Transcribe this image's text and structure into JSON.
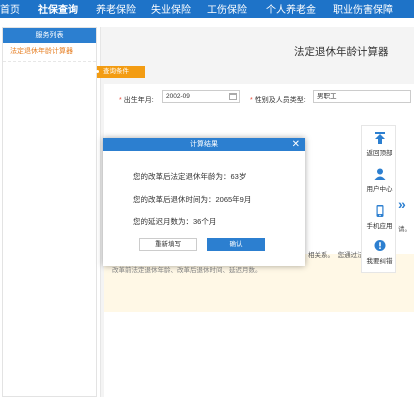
{
  "nav": {
    "items": [
      "首页",
      "社保查询",
      "养老保险",
      "失业保险",
      "工伤保险",
      "个人养老金",
      "职业伤害保障"
    ],
    "active_index": 1
  },
  "sidebar": {
    "header": "服务列表",
    "items": [
      {
        "label": "法定退休年龄计算器"
      }
    ]
  },
  "main": {
    "title": "法定退休年龄计算器",
    "query_tag": "查询条件",
    "fields": {
      "birth_label": "出生年月:",
      "birth_value": "2002-09",
      "identity_label": "性别及人员类型:",
      "identity_value": "男职工"
    },
    "notice_fragments": [
      "相关系。",
      "您通过法治",
      "请。",
      "改革前法定退休年龄、改革后退休时间、延迟月数。"
    ]
  },
  "modal": {
    "title": "计算结果",
    "close_glyph": "✕",
    "lines": [
      "您的改革后法定退休年龄为：63岁",
      "您的改革后退休时间为：2065年9月",
      "您的延迟月数为：36个月"
    ],
    "reset_label": "重新填写",
    "confirm_label": "确认"
  },
  "floatbar": {
    "items": [
      {
        "label": "返回顶部",
        "icon": "arrow-up-icon"
      },
      {
        "label": "用户中心",
        "icon": "user-icon"
      },
      {
        "label": "手机应用",
        "icon": "phone-icon"
      },
      {
        "label": "我要纠错",
        "icon": "feedback-icon"
      }
    ],
    "chevron": "»"
  },
  "colors": {
    "primary": "#2c7fd0",
    "nav": "#1e73c8",
    "accent": "#f39c12"
  }
}
